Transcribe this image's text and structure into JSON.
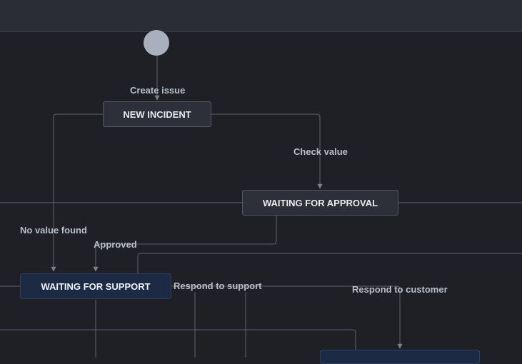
{
  "nodes": {
    "new_incident": "NEW INCIDENT",
    "waiting_for_approval": "WAITING FOR APPROVAL",
    "waiting_for_support": "WAITING FOR SUPPORT"
  },
  "transitions": {
    "create_issue": "Create issue",
    "check_value": "Check value",
    "no_value_found": "No value found",
    "approved": "Approved",
    "respond_to_support": "Respond to support",
    "respond_to_customer": "Respond to customer"
  },
  "colors": {
    "background": "#1e2026",
    "status_gray": "#2d3038",
    "status_blue": "#1d2a43",
    "line": "#5d626c",
    "start_node": "#a8b0bd"
  }
}
